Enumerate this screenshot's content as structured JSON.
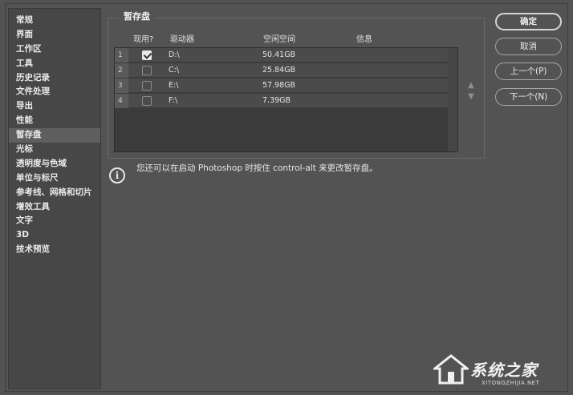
{
  "sidebar": {
    "items": [
      {
        "label": "常规"
      },
      {
        "label": "界面"
      },
      {
        "label": "工作区"
      },
      {
        "label": "工具"
      },
      {
        "label": "历史记录"
      },
      {
        "label": "文件处理"
      },
      {
        "label": "导出"
      },
      {
        "label": "性能"
      },
      {
        "label": "暂存盘",
        "active": true
      },
      {
        "label": "光标"
      },
      {
        "label": "透明度与色域"
      },
      {
        "label": "单位与标尺"
      },
      {
        "label": "参考线、网格和切片"
      },
      {
        "label": "增效工具"
      },
      {
        "label": "文字"
      },
      {
        "label": "3D"
      },
      {
        "label": "技术预览"
      }
    ]
  },
  "scratch": {
    "group_title": "暂存盘",
    "columns": {
      "active": "现用?",
      "drive": "驱动器",
      "free": "空闲空间",
      "info": "信息"
    },
    "rows": [
      {
        "index": "1",
        "checked": true,
        "drive": "D:\\",
        "free": "50.41GB",
        "info": ""
      },
      {
        "index": "2",
        "checked": false,
        "drive": "C:\\",
        "free": "25.84GB",
        "info": ""
      },
      {
        "index": "3",
        "checked": false,
        "drive": "E:\\",
        "free": "57.98GB",
        "info": ""
      },
      {
        "index": "4",
        "checked": false,
        "drive": "F:\\",
        "free": "7.39GB",
        "info": ""
      }
    ],
    "up_arrow_icon": "triangle-up-icon",
    "down_arrow_icon": "triangle-down-icon"
  },
  "info": {
    "icon": "info-icon",
    "message": "您还可以在启动 Photoshop 时按住 control-alt 来更改暂存盘。"
  },
  "buttons": {
    "ok": "确定",
    "cancel": "取消",
    "prev": "上一个(P)",
    "next": "下一个(N)"
  },
  "watermark": {
    "title": "系统之家",
    "site": "XITONGZHIJIA.NET"
  },
  "colors": {
    "background": "#535353",
    "sidebar_bg": "#474747",
    "selected_item": "#5f5f5f",
    "text": "#e6e6e6"
  }
}
